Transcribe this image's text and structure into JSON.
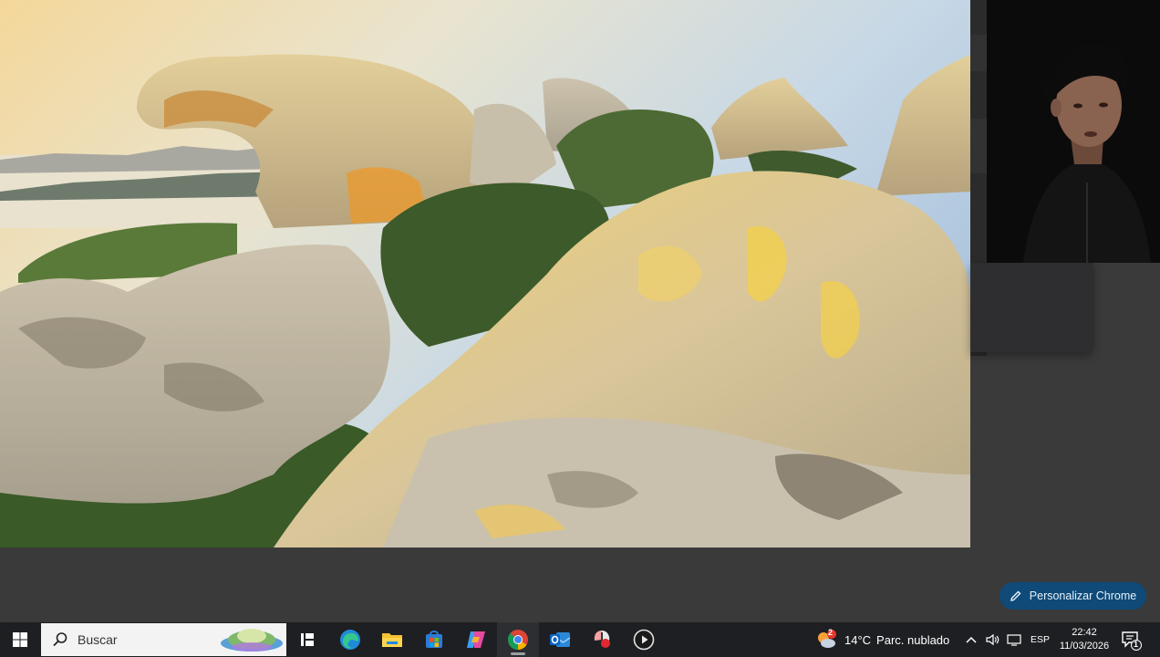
{
  "desktop": {
    "wallpaper_alt": "",
    "personalize_button": {
      "label": "Personalizar Chrome",
      "icon": "pencil-icon"
    }
  },
  "taskbar": {
    "start_icon": "windows-logo-icon",
    "search": {
      "placeholder": "Buscar",
      "icon": "search-icon"
    },
    "pinned": [
      {
        "name": "task-view",
        "icon": "task-view-icon"
      },
      {
        "name": "edge",
        "icon": "edge-icon"
      },
      {
        "name": "file-explorer",
        "icon": "folder-icon"
      },
      {
        "name": "microsoft-store",
        "icon": "store-icon"
      },
      {
        "name": "copilot",
        "icon": "copilot-icon"
      },
      {
        "name": "chrome",
        "icon": "chrome-icon",
        "active": true
      },
      {
        "name": "outlook",
        "icon": "outlook-icon"
      },
      {
        "name": "app-red",
        "icon": "app-icon"
      },
      {
        "name": "media-player",
        "icon": "play-icon"
      }
    ],
    "weather": {
      "temp": "14°C",
      "condition": "Parc. nublado",
      "badge": "2"
    },
    "tray": {
      "language": "ESP"
    },
    "clock": {
      "time": "22:42",
      "date": "11/03/2026"
    },
    "notifications": {
      "count": "1"
    }
  },
  "colors": {
    "accent": "#0f4a78",
    "taskbar": "#1e1f22",
    "desktop": "#3a3a3b"
  }
}
